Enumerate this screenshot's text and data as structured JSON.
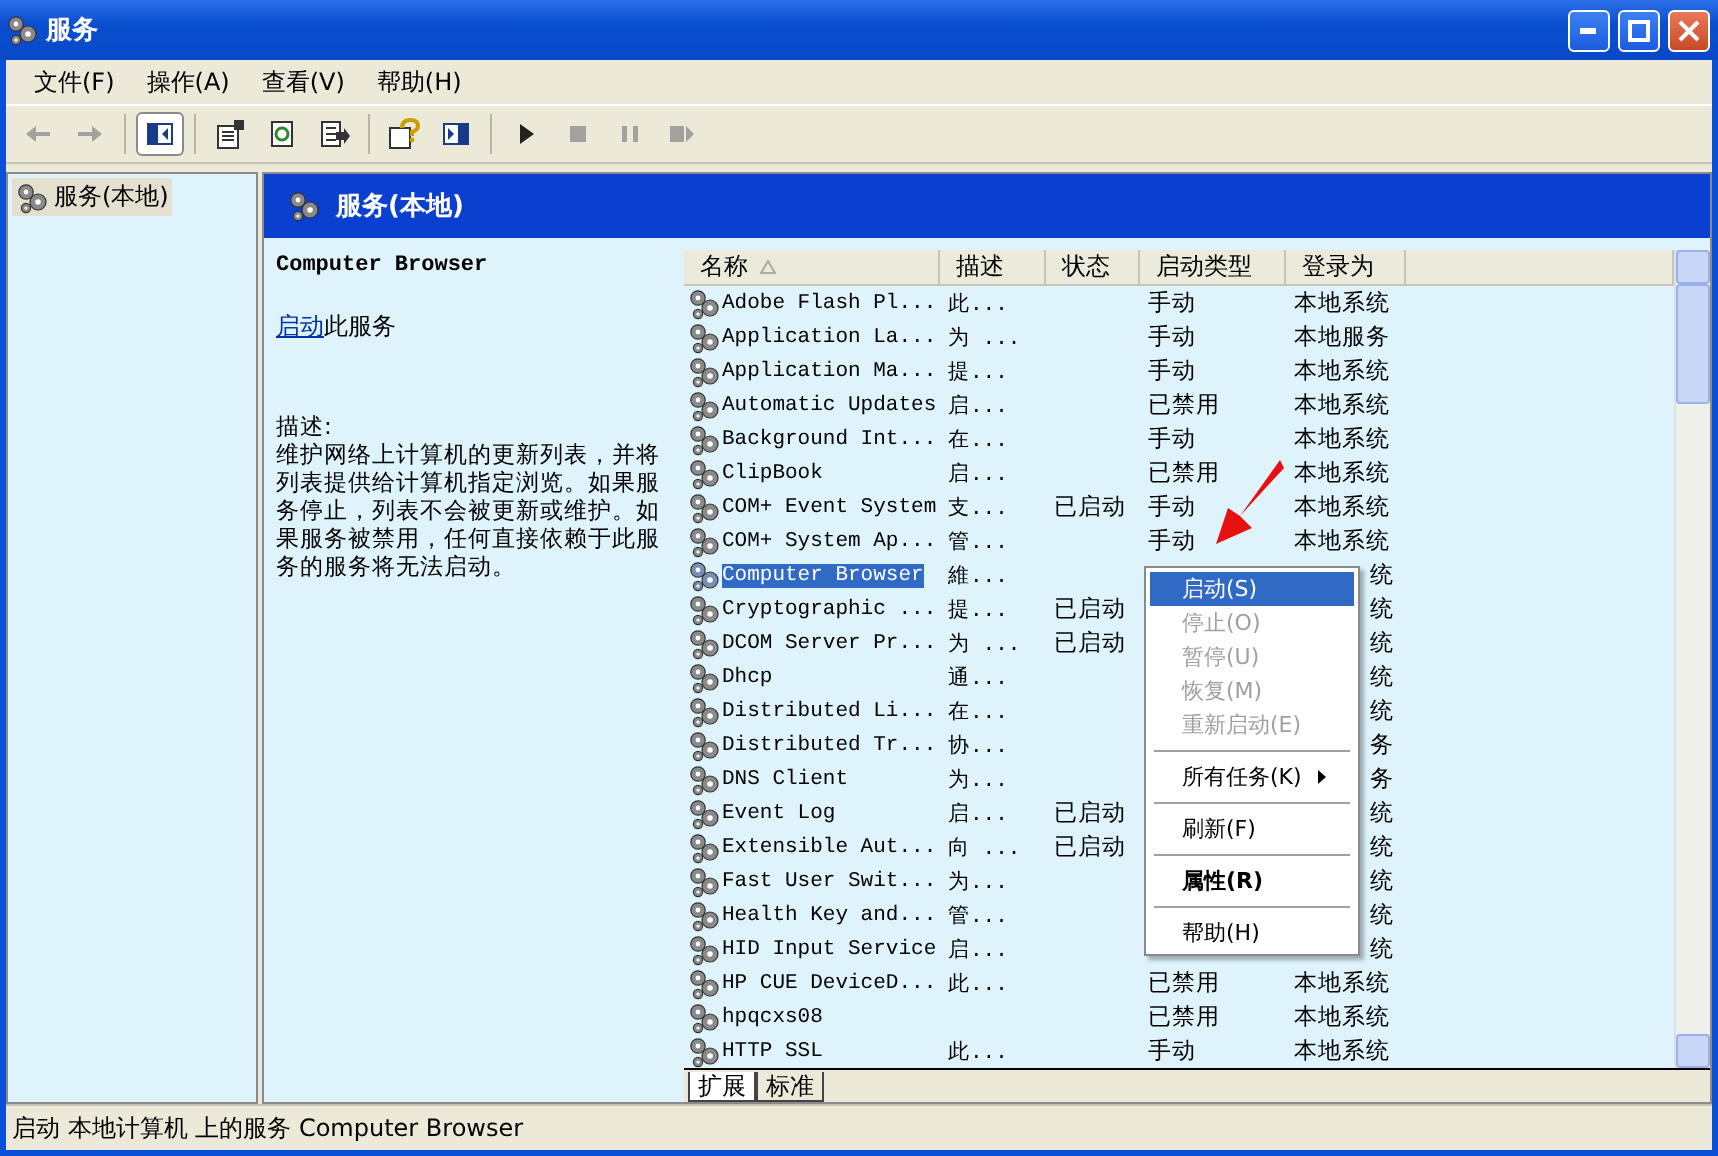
{
  "window": {
    "title": "服务"
  },
  "menu": [
    "文件(F)",
    "操作(A)",
    "查看(V)",
    "帮助(H)"
  ],
  "toolbar": [
    {
      "kind": "back",
      "disabled": true,
      "pressed": false
    },
    {
      "kind": "forward",
      "disabled": true,
      "pressed": false
    },
    {
      "kind": "separator"
    },
    {
      "kind": "tree",
      "disabled": false,
      "pressed": true
    },
    {
      "kind": "separator"
    },
    {
      "kind": "properties",
      "disabled": false,
      "pressed": false
    },
    {
      "kind": "refresh",
      "disabled": false,
      "pressed": false
    },
    {
      "kind": "export",
      "disabled": false,
      "pressed": false
    },
    {
      "kind": "separator"
    },
    {
      "kind": "help",
      "disabled": false,
      "pressed": false
    },
    {
      "kind": "pane",
      "disabled": false,
      "pressed": false
    },
    {
      "kind": "separator"
    },
    {
      "kind": "play",
      "disabled": false,
      "pressed": false
    },
    {
      "kind": "stop",
      "disabled": true,
      "pressed": false
    },
    {
      "kind": "pause",
      "disabled": true,
      "pressed": false
    },
    {
      "kind": "restart",
      "disabled": true,
      "pressed": false
    }
  ],
  "tree": {
    "items": [
      {
        "label": "服务(本地)",
        "selected": true
      }
    ]
  },
  "pane_header": {
    "title": "服务(本地)"
  },
  "details": {
    "title": "Computer Browser",
    "action_link": "启动",
    "action_text": "此服务",
    "description_label": "描述:",
    "description": "维护网络上计算机的更新列表，并将列表提供给计算机指定浏览。如果服务停止，列表不会被更新或维护。如果服务被禁用，任何直接依赖于此服务的服务将无法启动。"
  },
  "table": {
    "columns": [
      "名称",
      "描述",
      "状态",
      "启动类型",
      "登录为"
    ],
    "rows": [
      {
        "name": "Adobe Flash Pl...",
        "description": "此...",
        "status": "",
        "startup": "手动",
        "logon": "本地系统",
        "selected": false
      },
      {
        "name": "Application La...",
        "description": "为 ...",
        "status": "",
        "startup": "手动",
        "logon": "本地服务",
        "selected": false
      },
      {
        "name": "Application Ma...",
        "description": "提...",
        "status": "",
        "startup": "手动",
        "logon": "本地系统",
        "selected": false
      },
      {
        "name": "Automatic Updates",
        "description": "启...",
        "status": "",
        "startup": "已禁用",
        "logon": "本地系统",
        "selected": false
      },
      {
        "name": "Background Int...",
        "description": "在...",
        "status": "",
        "startup": "手动",
        "logon": "本地系统",
        "selected": false
      },
      {
        "name": "ClipBook",
        "description": "启...",
        "status": "",
        "startup": "已禁用",
        "logon": "本地系统",
        "selected": false
      },
      {
        "name": "COM+ Event System",
        "description": "支...",
        "status": "已启动",
        "startup": "手动",
        "logon": "本地系统",
        "selected": false
      },
      {
        "name": "COM+ System Ap...",
        "description": "管...",
        "status": "",
        "startup": "手动",
        "logon": "本地系统",
        "selected": false
      },
      {
        "name": "Computer Browser",
        "description": "維...",
        "status": "",
        "startup": "",
        "logon": "统",
        "selected": true
      },
      {
        "name": "Cryptographic ...",
        "description": "提...",
        "status": "已启动",
        "startup": "",
        "logon": "统",
        "selected": false
      },
      {
        "name": "DCOM Server Pr...",
        "description": "为 ...",
        "status": "已启动",
        "startup": "",
        "logon": "统",
        "selected": false
      },
      {
        "name": "Dhcp",
        "description": "通...",
        "status": "",
        "startup": "",
        "logon": "统",
        "selected": false
      },
      {
        "name": "Distributed Li...",
        "description": "在...",
        "status": "",
        "startup": "",
        "logon": "统",
        "selected": false
      },
      {
        "name": "Distributed Tr...",
        "description": "协...",
        "status": "",
        "startup": "",
        "logon": "务",
        "selected": false
      },
      {
        "name": "DNS Client",
        "description": "为...",
        "status": "",
        "startup": "",
        "logon": "务",
        "selected": false
      },
      {
        "name": "Event Log",
        "description": "启...",
        "status": "已启动",
        "startup": "",
        "logon": "统",
        "selected": false
      },
      {
        "name": "Extensible Aut...",
        "description": "向 ...",
        "status": "已启动",
        "startup": "",
        "logon": "统",
        "selected": false
      },
      {
        "name": "Fast User Swit...",
        "description": "为...",
        "status": "",
        "startup": "",
        "logon": "统",
        "selected": false
      },
      {
        "name": "Health Key and...",
        "description": "管...",
        "status": "",
        "startup": "",
        "logon": "统",
        "selected": false
      },
      {
        "name": "HID Input Service",
        "description": "启...",
        "status": "",
        "startup": "",
        "logon": "统",
        "selected": false
      },
      {
        "name": "HP CUE DeviceD...",
        "description": "此...",
        "status": "",
        "startup": "已禁用",
        "logon": "本地系统",
        "selected": false
      },
      {
        "name": "hpqcxs08",
        "description": "",
        "status": "",
        "startup": "已禁用",
        "logon": "本地系统",
        "selected": false
      },
      {
        "name": "HTTP SSL",
        "description": "此...",
        "status": "",
        "startup": "手动",
        "logon": "本地系统",
        "selected": false
      }
    ]
  },
  "tabs": [
    {
      "label": "扩展",
      "selected": true
    },
    {
      "label": "标准",
      "selected": false
    }
  ],
  "context_menu": [
    {
      "kind": "item",
      "label": "启动(S)",
      "selected": true,
      "disabled": false
    },
    {
      "kind": "item",
      "label": "停止(O)",
      "selected": false,
      "disabled": true
    },
    {
      "kind": "item",
      "label": "暂停(U)",
      "selected": false,
      "disabled": true
    },
    {
      "kind": "item",
      "label": "恢复(M)",
      "selected": false,
      "disabled": true
    },
    {
      "kind": "item",
      "label": "重新启动(E)",
      "selected": false,
      "disabled": true
    },
    {
      "kind": "separator"
    },
    {
      "kind": "submenu",
      "label": "所有任务(K)",
      "selected": false,
      "disabled": false
    },
    {
      "kind": "separator"
    },
    {
      "kind": "item",
      "label": "刷新(F)",
      "selected": false,
      "disabled": false
    },
    {
      "kind": "separator"
    },
    {
      "kind": "default",
      "label": "属性(R)",
      "selected": false,
      "disabled": false
    },
    {
      "kind": "separator"
    },
    {
      "kind": "item",
      "label": "帮助(H)",
      "selected": false,
      "disabled": false
    }
  ],
  "status_bar": "启动 本地计算机 上的服务 Computer Browser"
}
